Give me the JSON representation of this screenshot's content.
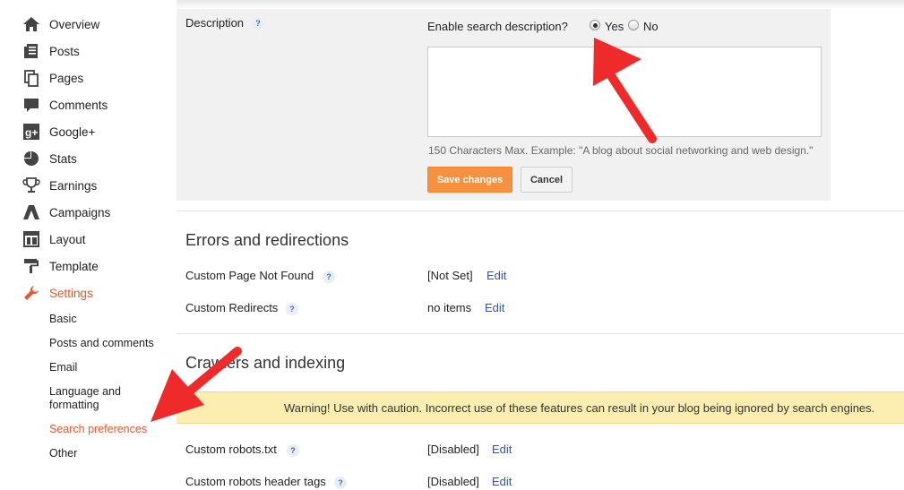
{
  "sidebar": {
    "items": [
      {
        "label": "Overview",
        "icon": "home-icon"
      },
      {
        "label": "Posts",
        "icon": "posts-icon"
      },
      {
        "label": "Pages",
        "icon": "pages-icon"
      },
      {
        "label": "Comments",
        "icon": "comments-icon"
      },
      {
        "label": "Google+",
        "icon": "google-plus-icon"
      },
      {
        "label": "Stats",
        "icon": "stats-icon"
      },
      {
        "label": "Earnings",
        "icon": "trophy-icon"
      },
      {
        "label": "Campaigns",
        "icon": "campaigns-icon"
      },
      {
        "label": "Layout",
        "icon": "layout-icon"
      },
      {
        "label": "Template",
        "icon": "template-icon"
      },
      {
        "label": "Settings",
        "icon": "wrench-icon",
        "active": true
      }
    ],
    "subitems": [
      {
        "label": "Basic"
      },
      {
        "label": "Posts and comments"
      },
      {
        "label": "Email"
      },
      {
        "label": "Language and formatting"
      },
      {
        "label": "Search preferences",
        "active": true
      },
      {
        "label": "Other"
      }
    ]
  },
  "description": {
    "label": "Description",
    "help": "?",
    "enable_question": "Enable search description?",
    "yes_label": "Yes",
    "no_label": "No",
    "selected": "Yes",
    "text_value": "",
    "note": "150 Characters Max. Example: \"A blog about social networking and web design.\"",
    "save_label": "Save changes",
    "cancel_label": "Cancel"
  },
  "errors": {
    "title": "Errors and redirections",
    "rows": [
      {
        "label": "Custom Page Not Found",
        "value": "[Not Set]",
        "edit": "Edit"
      },
      {
        "label": "Custom Redirects",
        "value": "no items",
        "edit": "Edit"
      }
    ]
  },
  "crawlers": {
    "title": "Crawlers and indexing",
    "warning": "Warning! Use with caution. Incorrect use of these features can result in your blog being ignored by search engines.",
    "rows": [
      {
        "label": "Custom robots.txt",
        "value": "[Disabled]",
        "edit": "Edit"
      },
      {
        "label": "Custom robots header tags",
        "value": "[Disabled]",
        "edit": "Edit"
      }
    ]
  },
  "colors": {
    "accent": "#e8572b",
    "save_button": "#f6923f",
    "link": "#2a56c6",
    "warning_bg": "#fbeeb0",
    "arrow": "#ee2a2a"
  }
}
